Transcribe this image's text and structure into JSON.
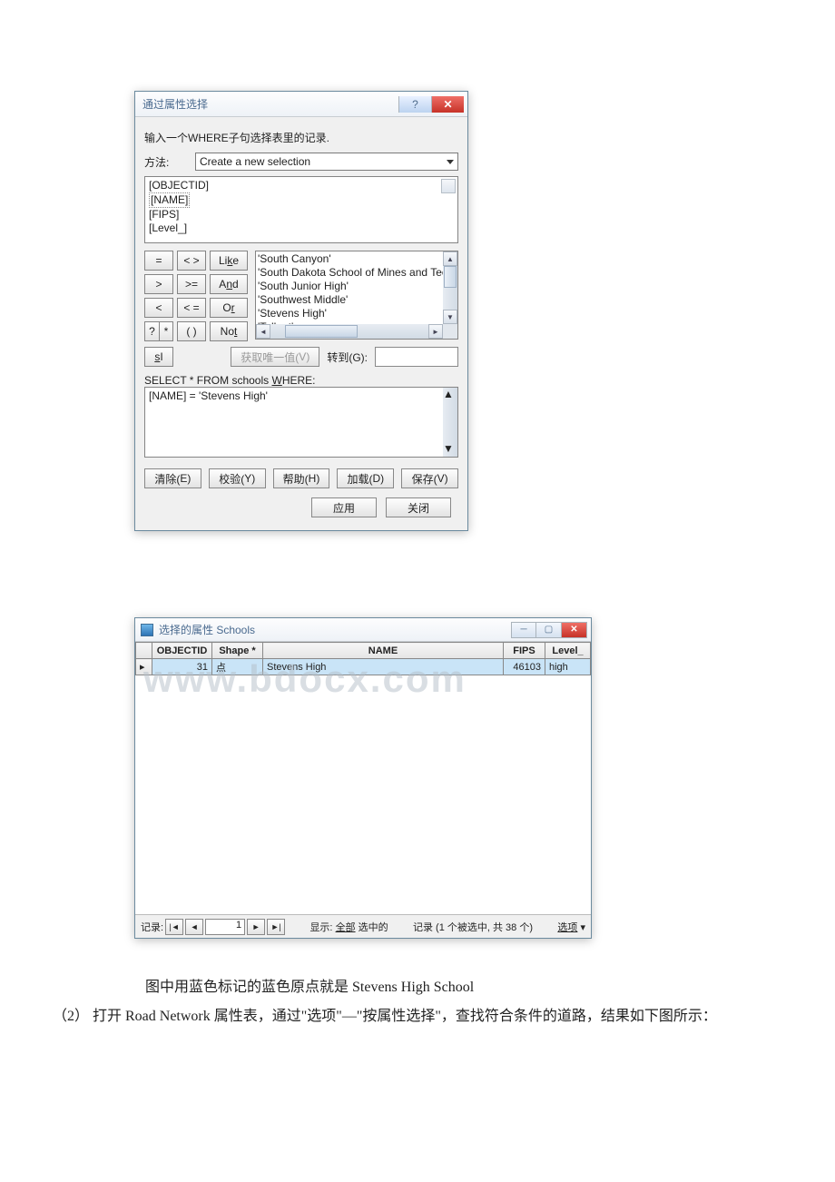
{
  "dialog1": {
    "title": "通过属性选择",
    "instruction": "输入一个WHERE子句选择表里的记录.",
    "method_label": "方法:",
    "method_value": "Create a new selection",
    "fields": [
      "[OBJECTID]",
      "[NAME]",
      "[FIPS]",
      "[Level_]"
    ],
    "ops": {
      "eq": "=",
      "neq": "< >",
      "like_u": "k",
      "like_pre": "Li",
      "and_u": "n",
      "and_pre": "A",
      "and_suf": "d",
      "gt": ">",
      "gte": ">=",
      "or_u": "r",
      "or_pre": "O",
      "lt": "<",
      "lte": "< =",
      "q": "?",
      "star": "*",
      "paren": "( )",
      "not_u": "t",
      "not_pre": "No",
      "is_u": "s",
      "is_pre": "I"
    },
    "values": [
      "'South Canyon'",
      "'South Dakota School of Mines and Techn",
      "'South Junior High'",
      "'Southwest Middle'",
      "'Stevens High'",
      "'Tallent'"
    ],
    "get_unique": "获取唯一值(V)",
    "get_unique_u": "V",
    "goto_label": "转到(G):",
    "goto_u": "G",
    "sql_prefix1": "SELECT * FROM schools ",
    "sql_where_u": "W",
    "sql_where_suf": "HERE:",
    "expr": "[NAME] = 'Stevens High'",
    "btns": {
      "clear": "清除(E)",
      "verify": "校验(Y)",
      "help": "帮助(H)",
      "load": "加载(D)",
      "save": "保存(V)",
      "clear_u": "E",
      "verify_u": "Y",
      "help_u": "H",
      "load_u": "D",
      "save_u": "V",
      "apply": "应用",
      "close": "关闭"
    }
  },
  "dialog2": {
    "title": "选择的属性 Schools",
    "headers": {
      "objectid": "OBJECTID",
      "shape": "Shape *",
      "name": "NAME",
      "fips": "FIPS",
      "level": "Level_"
    },
    "row": {
      "objectid": "31",
      "shape": "点",
      "name": "Stevens High",
      "fips": "46103",
      "level": "high"
    },
    "record_label": "记录:",
    "record_value": "1",
    "show_label": "显示:",
    "show_all": "全部",
    "show_selected": "选中的",
    "status": "记录 (1 个被选中, 共 38 个)",
    "options": "选项"
  },
  "watermark": "www.bdocx.com",
  "caption1": "图中用蓝色标记的蓝色原点就是 Stevens High School",
  "caption2": "（2） 打开 Road Network 属性表，通过\"选项\"—\"按属性选择\"，查找符合条件的道路，结果如下图所示："
}
